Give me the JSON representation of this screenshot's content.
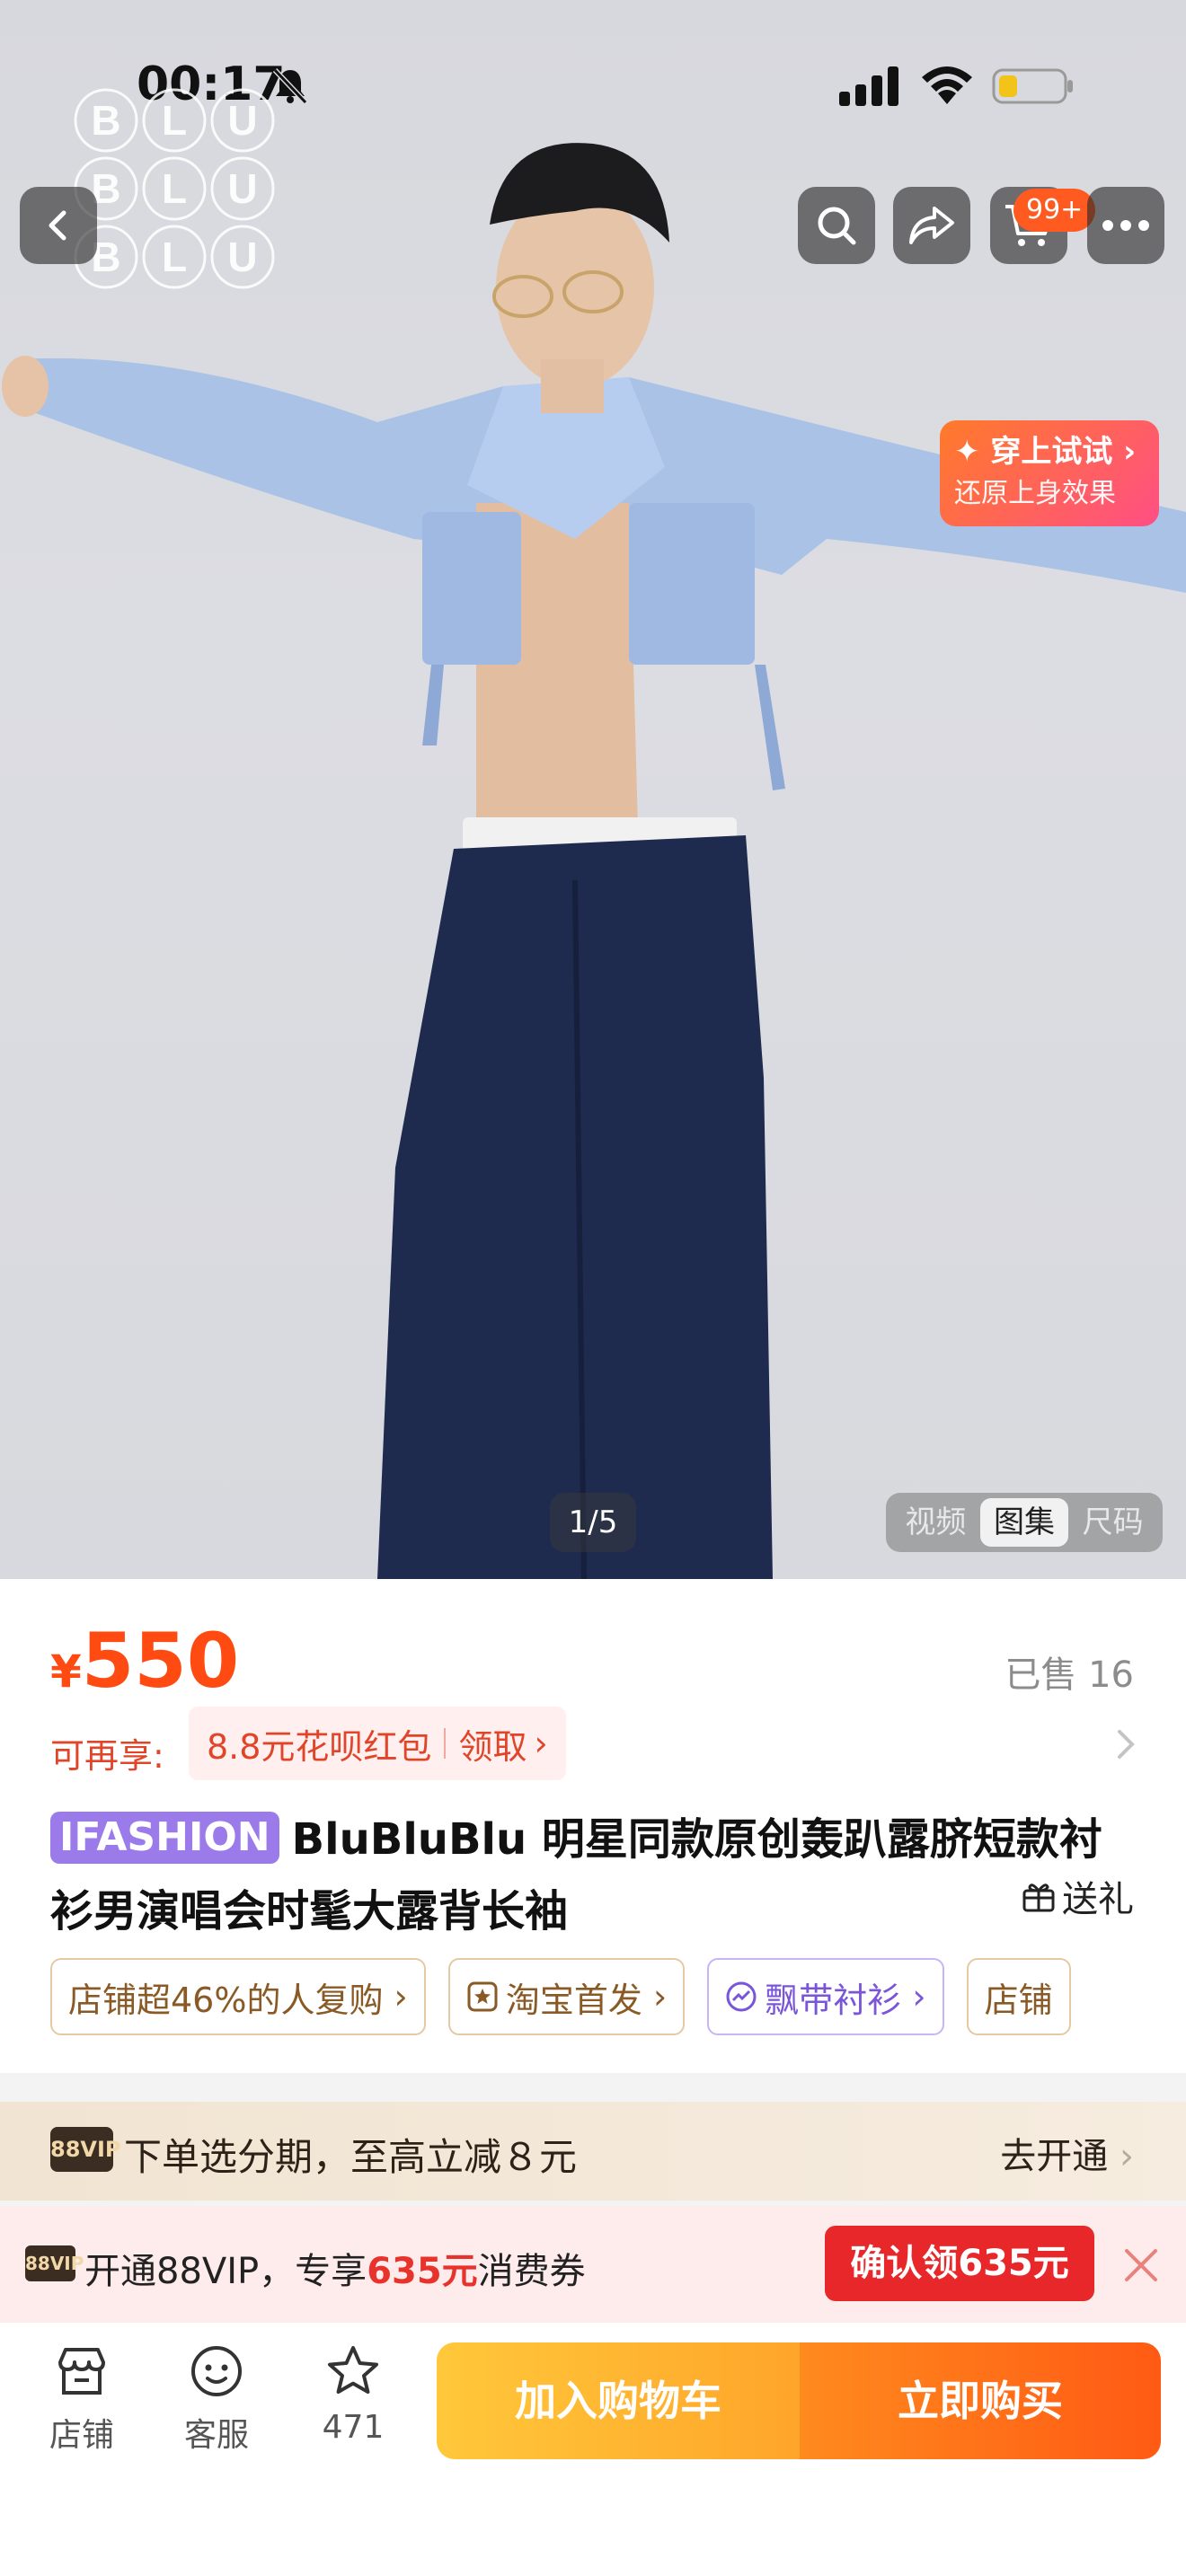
{
  "status_bar": {
    "time": "00:17"
  },
  "header": {
    "brand_logo_text": [
      "B",
      "L",
      "U"
    ],
    "cart_badge": "99+"
  },
  "hero": {
    "image_description": "",
    "tryon_title": "✦ 穿上试试",
    "tryon_subtitle": "还原上身效果",
    "image_counter": "1/5",
    "media_tabs": [
      {
        "label": "视频",
        "active": false
      },
      {
        "label": "图集",
        "active": true
      },
      {
        "label": "尺码",
        "active": false
      }
    ]
  },
  "product": {
    "currency": "¥",
    "price": "550",
    "sold": "已售 16",
    "promo_label": "可再享:",
    "promo_offer": "8.8元花呗红包",
    "promo_action": "领取",
    "title_badge": "IFASHION",
    "title": "BluBluBlu 明星同款原创轰趴露脐短款衬衫男演唱会时髦大露背长袖",
    "gift_label": "送礼",
    "tags": [
      {
        "label": "店铺超46%的人复购",
        "style": "gold"
      },
      {
        "label": "淘宝首发",
        "style": "gold"
      },
      {
        "label": "飘带衬衫",
        "style": "purple"
      },
      {
        "label": "店铺",
        "style": "gold"
      }
    ]
  },
  "vip_banner": {
    "logo": "88VIP",
    "text": "下单选分期，至高立减８元",
    "cta": "去开通"
  },
  "coupon_banner": {
    "logo": "88VIP",
    "text_prefix": "开通88VIP，专享",
    "amount": "635元",
    "text_suffix": "消费券",
    "button": "确认领635元"
  },
  "bottom_bar": {
    "shop_label": "店铺",
    "service_label": "客服",
    "favorites_count": "471",
    "add_to_cart": "加入购物车",
    "buy_now": "立即购买"
  },
  "colors": {
    "price": "#ff4b12",
    "accent_orange": "#ff5a14",
    "accent_yellow": "#ffc83a",
    "coupon_red": "#e8272a",
    "ifashion_purple": "#9b7bea"
  }
}
